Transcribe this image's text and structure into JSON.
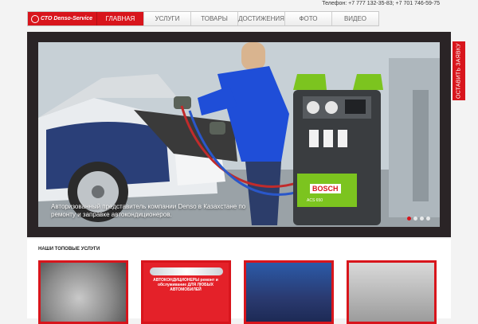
{
  "header": {
    "phone_text": "Телефон: +7 777 132-35-83; +7 701 746-59-75",
    "logo_text": "СТО Denso-Service"
  },
  "nav": {
    "items": [
      {
        "label": "ГЛАВНАЯ"
      },
      {
        "label": "УСЛУГИ"
      },
      {
        "label": "ТОВАРЫ"
      },
      {
        "label": "ДОСТИЖЕНИЯ"
      },
      {
        "label": "ФОТО"
      },
      {
        "label": "ВИДЕО"
      }
    ]
  },
  "side_tab": {
    "label": "ОСТАВИТЬ ЗАЯВКУ"
  },
  "hero": {
    "caption": "Авторизованный представитель компании Denso в Казахстане по ремонту и заправке автокондиционеров.",
    "brand_badge": "BOSCH",
    "model_label": "ACS 650"
  },
  "services": {
    "title": "НАШИ ТОПОВЫЕ УСЛУГИ",
    "card2_label": "АВТОКОНДИЦИОНЕРЫ ремонт и обслуживание ДЛЯ ЛЮБЫХ АВТОМОБИЛЕЙ"
  },
  "colors": {
    "accent": "#d8151c",
    "machine_green": "#7cc41f"
  }
}
